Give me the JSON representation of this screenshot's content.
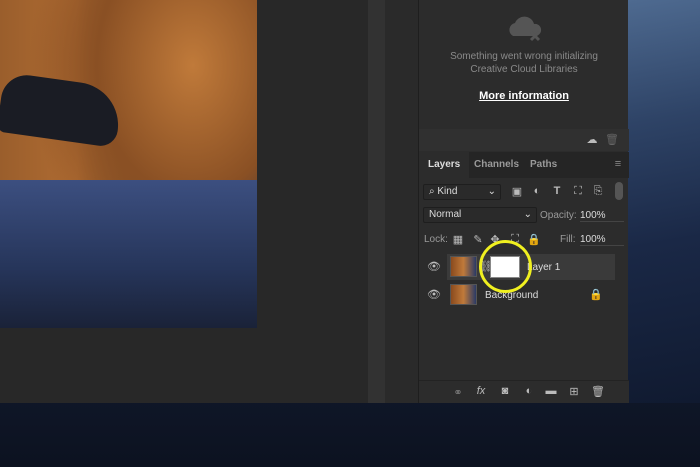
{
  "libraries": {
    "error_line1": "Something went wrong initializing",
    "error_line2": "Creative Cloud Libraries",
    "more_info": "More information"
  },
  "tabs": [
    {
      "label": "Layers",
      "active": true
    },
    {
      "label": "Channels"
    },
    {
      "label": "Paths"
    }
  ],
  "filter": {
    "kind": "Kind"
  },
  "blend": {
    "mode": "Normal",
    "opacity_label": "Opacity:",
    "opacity": "100%"
  },
  "lock": {
    "label": "Lock:",
    "fill_label": "Fill:",
    "fill": "100%"
  },
  "layers": [
    {
      "name": "Layer 1",
      "selected": true,
      "has_mask": true
    },
    {
      "name": "Background",
      "locked": true
    }
  ],
  "highlight_color": "#f0f020"
}
